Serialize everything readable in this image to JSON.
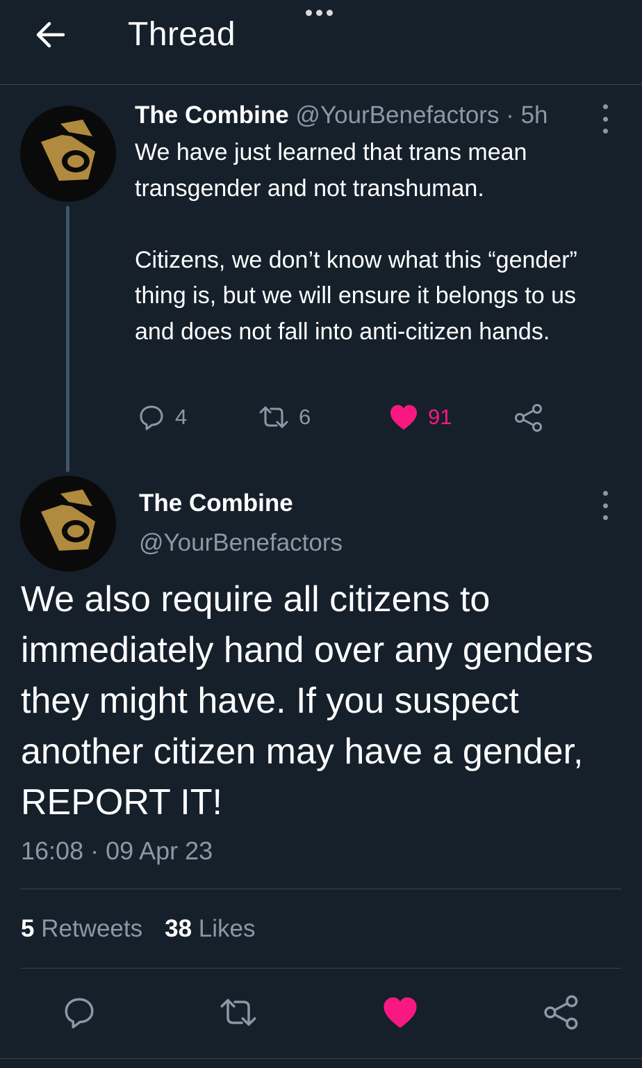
{
  "header": {
    "title": "Thread"
  },
  "tweet1": {
    "author_name": "The Combine",
    "author_handle": "@YourBenefactors",
    "time_sep": " · ",
    "time": "5h",
    "text": "We have just learned that trans mean transgender and not transhuman.\n\nCitizens, we don’t know what this “gender” thing is, but we will ensure it belongs to us and does not fall into anti-citizen hands.",
    "replies": "4",
    "retweets": "6",
    "likes": "91"
  },
  "tweet2": {
    "author_name": "The Combine",
    "author_handle": "@YourBenefactors",
    "text": "We also require all citizens to immediately hand over any genders they might have. If you suspect another citizen may have a gender, REPORT IT!",
    "timestamp": "16:08 · 09 Apr 23",
    "retweet_count": "5",
    "retweet_label": "Retweets",
    "like_count": "38",
    "like_label": "Likes"
  },
  "colors": {
    "background": "#15202b",
    "muted": "#8b98a5",
    "like": "#f91880",
    "avatar_emblem": "#b08a3e"
  },
  "icons": {
    "back": "arrow-left-icon",
    "more": "more-vertical-icon",
    "reply": "reply-icon",
    "retweet": "retweet-icon",
    "like": "heart-filled-icon",
    "share": "share-icon"
  }
}
